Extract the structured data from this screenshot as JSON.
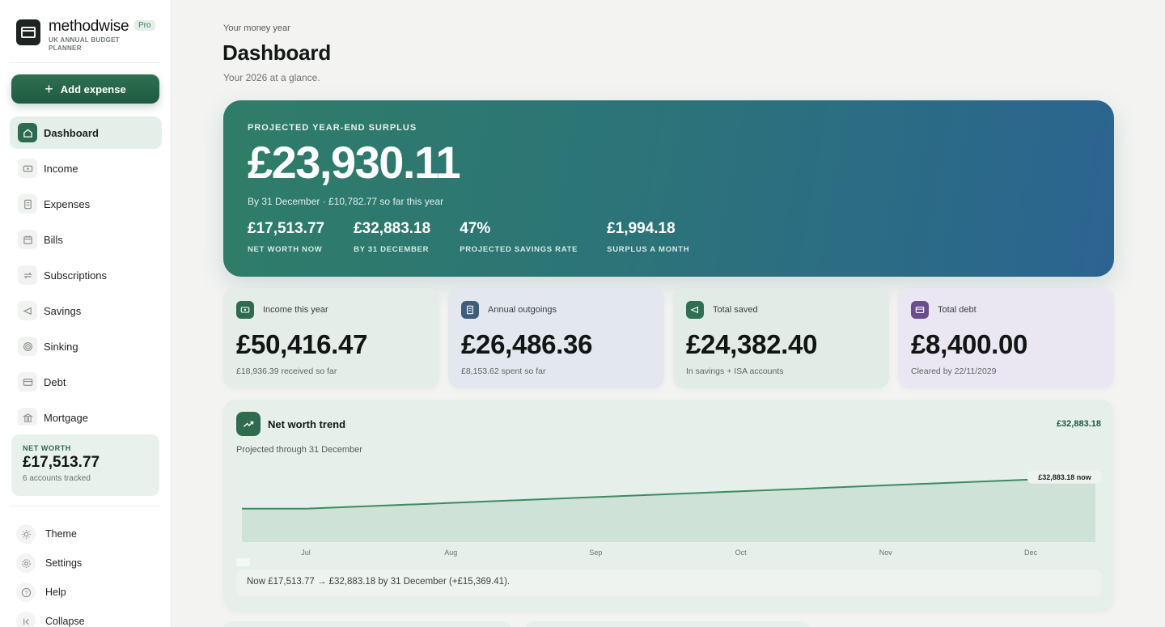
{
  "brand": {
    "name": "methodwise",
    "subtitle": "UK ANNUAL BUDGET PLANNER",
    "badge": "Pro"
  },
  "add_expense_label": "Add expense",
  "nav": {
    "items": [
      {
        "label": "Dashboard",
        "icon": "home-icon",
        "active": true
      },
      {
        "label": "Income",
        "icon": "banknote-icon"
      },
      {
        "label": "Expenses",
        "icon": "receipt-icon"
      },
      {
        "label": "Bills",
        "icon": "calendar-icon"
      },
      {
        "label": "Subscriptions",
        "icon": "repeat-icon"
      },
      {
        "label": "Savings",
        "icon": "piggy-bank-icon"
      },
      {
        "label": "Sinking",
        "icon": "target-icon"
      },
      {
        "label": "Debt",
        "icon": "credit-card-icon"
      },
      {
        "label": "Mortgage",
        "icon": "bank-icon"
      }
    ]
  },
  "net_worth_card": {
    "label": "NET WORTH",
    "value": "£17,513.77",
    "sub": "6 accounts tracked"
  },
  "bottom_nav": {
    "items": [
      {
        "label": "Theme",
        "icon": "sun-icon"
      },
      {
        "label": "Settings",
        "icon": "gear-icon"
      },
      {
        "label": "Help",
        "icon": "help-icon"
      },
      {
        "label": "Collapse",
        "icon": "collapse-icon"
      }
    ]
  },
  "header": {
    "eyebrow": "Your money year",
    "title": "Dashboard",
    "subtitle": "Your 2026 at a glance."
  },
  "hero": {
    "label": "PROJECTED YEAR-END SURPLUS",
    "value": "£23,930.11",
    "sub": "By 31 December · £10,782.77 so far this year",
    "stats": [
      {
        "value": "£17,513.77",
        "label": "NET WORTH NOW"
      },
      {
        "value": "£32,883.18",
        "label": "BY 31 DECEMBER"
      },
      {
        "value": "47%",
        "label": "PROJECTED SAVINGS RATE"
      },
      {
        "value": "£1,994.18",
        "label": "SURPLUS A MONTH"
      }
    ]
  },
  "cards": [
    {
      "title": "Income this year",
      "value": "£50,416.47",
      "sub": "£18,936.39 received so far",
      "icon": "banknote-icon"
    },
    {
      "title": "Annual outgoings",
      "value": "£26,486.36",
      "sub": "£8,153.62 spent so far",
      "icon": "receipt-icon"
    },
    {
      "title": "Total saved",
      "value": "£24,382.40",
      "sub": "In savings + ISA accounts",
      "icon": "piggy-bank-icon"
    },
    {
      "title": "Total debt",
      "value": "£8,400.00",
      "sub": "Cleared by 22/11/2029",
      "icon": "credit-card-icon"
    }
  ],
  "trend": {
    "title": "Net worth trend",
    "right_value": "£32,883.18",
    "subtitle": "Projected through 31 December",
    "end_label": "£32,883.18 now",
    "footer": "Now £17,513.77 → £32,883.18 by 31 December (+£15,369.41)."
  },
  "chart_data": {
    "type": "area",
    "x": [
      "Jul",
      "Aug",
      "Sep",
      "Oct",
      "Nov",
      "Dec"
    ],
    "values": [
      17513.77,
      20588,
      23662,
      26735,
      29809,
      32883.18
    ],
    "line_color": "#3d8a64",
    "fill_color": "#cfe2d7"
  }
}
